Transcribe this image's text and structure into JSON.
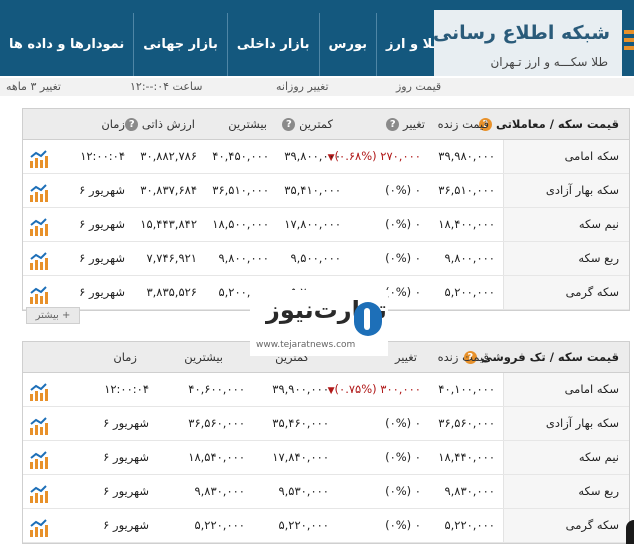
{
  "site": {
    "title": "شبکه اطلاع رسانی",
    "subtitle": "طلا سکـــه و ارز تـهران"
  },
  "nav": [
    "طلا و ارز",
    "بورس",
    "بازار داخلی",
    "بازار جهانی",
    "نمودارها و داده ها"
  ],
  "subbar": {
    "price_label": "قیمت روز",
    "daily_change": "تغییر روزانه",
    "time_label": "ساعت ۰۴:--:۱۲",
    "three_month": "تغییر ۳ ماهه"
  },
  "panel1": {
    "title": "قیمت سکه / معاملاتی",
    "headers": {
      "live": "قیمت زنده",
      "change": "تغییر",
      "min": "کمترین",
      "max": "بیشترین",
      "intrinsic": "ارزش ذاتی",
      "time": "زمان"
    },
    "rows": [
      {
        "name": "سکه امامی",
        "live": "۳۹,۹۸۰,۰۰۰",
        "change": "(۰.۶۸%) ۲۷۰,۰۰۰",
        "change_dir": "down",
        "min": "۳۹,۸۰۰,۰۰۰",
        "max": "۴۰,۴۵۰,۰۰۰",
        "intrinsic": "۳۰,۸۸۲,۷۸۶",
        "time": "۱۲:۰۰:۰۴"
      },
      {
        "name": "سکه بهار آزادی",
        "live": "۳۶,۵۱۰,۰۰۰",
        "change": "(۰%) ۰",
        "change_dir": "flat",
        "min": "۳۵,۴۱۰,۰۰۰",
        "max": "۳۶,۵۱۰,۰۰۰",
        "intrinsic": "۳۰,۸۳۷,۶۸۴",
        "time": "۶ شهریور"
      },
      {
        "name": "نیم سکه",
        "live": "۱۸,۴۰۰,۰۰۰",
        "change": "(۰%) ۰",
        "change_dir": "flat",
        "min": "۱۷,۸۰۰,۰۰۰",
        "max": "۱۸,۵۰۰,۰۰۰",
        "intrinsic": "۱۵,۴۴۳,۸۴۲",
        "time": "۶ شهریور"
      },
      {
        "name": "ربع سکه",
        "live": "۹,۸۰۰,۰۰۰",
        "change": "(۰%) ۰",
        "change_dir": "flat",
        "min": "۹,۵۰۰,۰۰۰",
        "max": "۹,۸۰۰,۰۰۰",
        "intrinsic": "۷,۷۴۶,۹۲۱",
        "time": "۶ شهریور"
      },
      {
        "name": "سکه گرمی",
        "live": "۵,۲۰۰,۰۰۰",
        "change": "(۰%) ۰",
        "change_dir": "flat",
        "min": "۵,۲۰۰,۰۰۰",
        "max": "۵,۲۰۰,۰۰۰",
        "intrinsic": "۳,۸۳۵,۵۲۶",
        "time": "۶ شهریور"
      }
    ],
    "more": "بیشتر +"
  },
  "panel2": {
    "title": "قیمت سکه / تک فروشی",
    "headers": {
      "live": "قیمت زنده",
      "change": "تغییر",
      "min": "کمترین",
      "max": "بیشترین",
      "time": "زمان"
    },
    "rows": [
      {
        "name": "سکه امامی",
        "live": "۴۰,۱۰۰,۰۰۰",
        "change": "(۰.۷۵%) ۳۰۰,۰۰۰",
        "change_dir": "down",
        "min": "۳۹,۹۰۰,۰۰۰",
        "max": "۴۰,۶۰۰,۰۰۰",
        "time": "۱۲:۰۰:۰۴"
      },
      {
        "name": "سکه بهار آزادی",
        "live": "۳۶,۵۶۰,۰۰۰",
        "change": "(۰%) ۰",
        "change_dir": "flat",
        "min": "۳۵,۴۶۰,۰۰۰",
        "max": "۳۶,۵۶۰,۰۰۰",
        "time": "۶ شهریور"
      },
      {
        "name": "نیم سکه",
        "live": "۱۸,۴۴۰,۰۰۰",
        "change": "(۰%) ۰",
        "change_dir": "flat",
        "min": "۱۷,۸۴۰,۰۰۰",
        "max": "۱۸,۵۴۰,۰۰۰",
        "time": "۶ شهریور"
      },
      {
        "name": "ربع سکه",
        "live": "۹,۸۳۰,۰۰۰",
        "change": "(۰%) ۰",
        "change_dir": "flat",
        "min": "۹,۵۳۰,۰۰۰",
        "max": "۹,۸۳۰,۰۰۰",
        "time": "۶ شهریور"
      },
      {
        "name": "سکه گرمی",
        "live": "۵,۲۲۰,۰۰۰",
        "change": "(۰%) ۰",
        "change_dir": "flat",
        "min": "۵,۲۲۰,۰۰۰",
        "max": "۵,۲۲۰,۰۰۰",
        "time": "۶ شهریور"
      }
    ]
  },
  "watermark": {
    "brand": "تجارت‌نیوز",
    "url": "www.tejaratnews.com"
  },
  "colors": {
    "header_bg": "#14587e",
    "accent": "#e8912a",
    "negative": "#b01818"
  }
}
